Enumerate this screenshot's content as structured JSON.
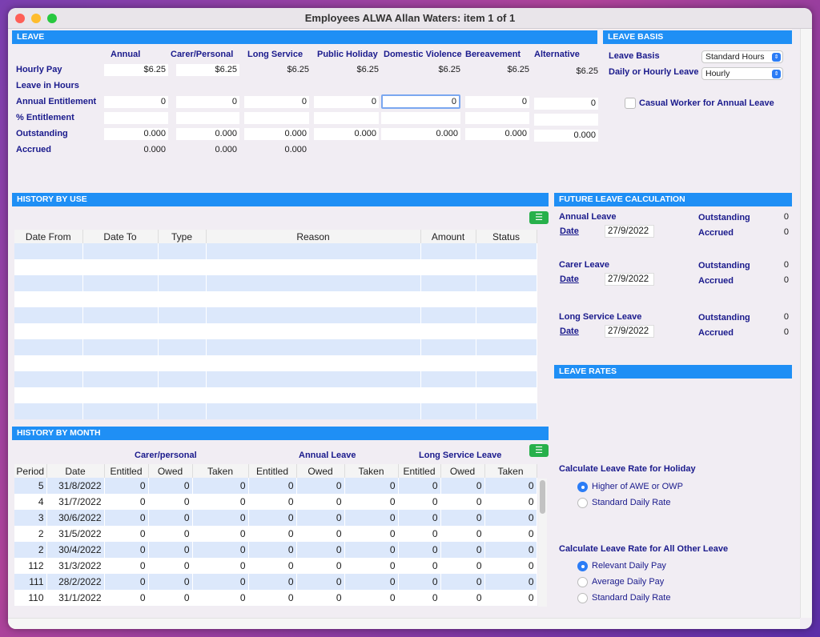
{
  "window": {
    "title": "Employees ALWA Allan Waters: item 1  of  1"
  },
  "leave": {
    "header": "LEAVE",
    "columns": [
      "Annual",
      "Carer/Personal",
      "Long Service",
      "Public Holiday",
      "Domestic Violence",
      "Bereavement",
      "Alternative"
    ],
    "row_labels": {
      "hourly_pay": "Hourly Pay",
      "leave_in_hours": "Leave in Hours",
      "annual_entitlement": "Annual Entitlement",
      "pct_entitlement": "% Entitlement",
      "outstanding": "Outstanding",
      "accrued": "Accrued"
    },
    "hourly_pay": [
      "$6.25",
      "$6.25",
      "$6.25",
      "$6.25",
      "$6.25",
      "$6.25",
      "$6.25"
    ],
    "annual_entitlement": [
      "0",
      "0",
      "0",
      "0",
      "0",
      "0",
      "0"
    ],
    "pct_entitlement": [
      "",
      "",
      "",
      "",
      "",
      "",
      ""
    ],
    "outstanding": [
      "0.000",
      "0.000",
      "0.000",
      "0.000",
      "0.000",
      "0.000",
      "0.000"
    ],
    "accrued": [
      "0.000",
      "0.000",
      "0.000"
    ]
  },
  "leave_basis": {
    "header": "LEAVE BASIS",
    "basis_label": "Leave Basis",
    "basis_value": "Standard Hours",
    "daily_hourly_label": "Daily or Hourly Leave",
    "daily_hourly_value": "Hourly",
    "casual_label": "Casual Worker for Annual Leave",
    "casual_checked": false
  },
  "history_by_use": {
    "header": "HISTORY BY USE",
    "columns": [
      "Date From",
      "Date To",
      "Type",
      "Reason",
      "Amount",
      "Status"
    ],
    "rows": []
  },
  "future": {
    "header": "FUTURE LEAVE CALCULATION",
    "outstanding_label": "Outstanding",
    "accrued_label": "Accrued",
    "date_label": "Date",
    "items": [
      {
        "title": "Annual Leave",
        "date": "27/9/2022",
        "outstanding": "0",
        "accrued": "0"
      },
      {
        "title": "Carer Leave",
        "date": "27/9/2022",
        "outstanding": "0",
        "accrued": "0"
      },
      {
        "title": "Long Service Leave",
        "date": "27/9/2022",
        "outstanding": "0",
        "accrued": "0"
      }
    ]
  },
  "leave_rates": {
    "header": "LEAVE RATES",
    "holiday_label": "Calculate Leave Rate for Holiday",
    "holiday_options": [
      "Higher of AWE or OWP",
      "Standard Daily Rate"
    ],
    "holiday_selected": 0,
    "other_label": "Calculate Leave Rate for All Other Leave",
    "other_options": [
      "Relevant Daily Pay",
      "Average Daily Pay",
      "Standard Daily Rate"
    ],
    "other_selected": 0
  },
  "history_by_month": {
    "header": "HISTORY BY MONTH",
    "groups": [
      "Carer/personal",
      "Annual Leave",
      "Long Service Leave"
    ],
    "columns": [
      "Period",
      "Date",
      "Entitled",
      "Owed",
      "Taken",
      "Entitled",
      "Owed",
      "Taken",
      "Entitled",
      "Owed",
      "Taken"
    ],
    "rows": [
      [
        "5",
        "31/8/2022",
        "0",
        "0",
        "0",
        "0",
        "0",
        "0",
        "0",
        "0",
        "0"
      ],
      [
        "4",
        "31/7/2022",
        "0",
        "0",
        "0",
        "0",
        "0",
        "0",
        "0",
        "0",
        "0"
      ],
      [
        "3",
        "30/6/2022",
        "0",
        "0",
        "0",
        "0",
        "0",
        "0",
        "0",
        "0",
        "0"
      ],
      [
        "2",
        "31/5/2022",
        "0",
        "0",
        "0",
        "0",
        "0",
        "0",
        "0",
        "0",
        "0"
      ],
      [
        "2",
        "30/4/2022",
        "0",
        "0",
        "0",
        "0",
        "0",
        "0",
        "0",
        "0",
        "0"
      ],
      [
        "112",
        "31/3/2022",
        "0",
        "0",
        "0",
        "0",
        "0",
        "0",
        "0",
        "0",
        "0"
      ],
      [
        "111",
        "28/2/2022",
        "0",
        "0",
        "0",
        "0",
        "0",
        "0",
        "0",
        "0",
        "0"
      ],
      [
        "110",
        "31/1/2022",
        "0",
        "0",
        "0",
        "0",
        "0",
        "0",
        "0",
        "0",
        "0"
      ]
    ]
  },
  "colors": {
    "header_blue": "#1f8ff5",
    "label_navy": "#1a1a8c",
    "row_stripe": "#dce8fb",
    "list_button_green": "#27b04b"
  }
}
